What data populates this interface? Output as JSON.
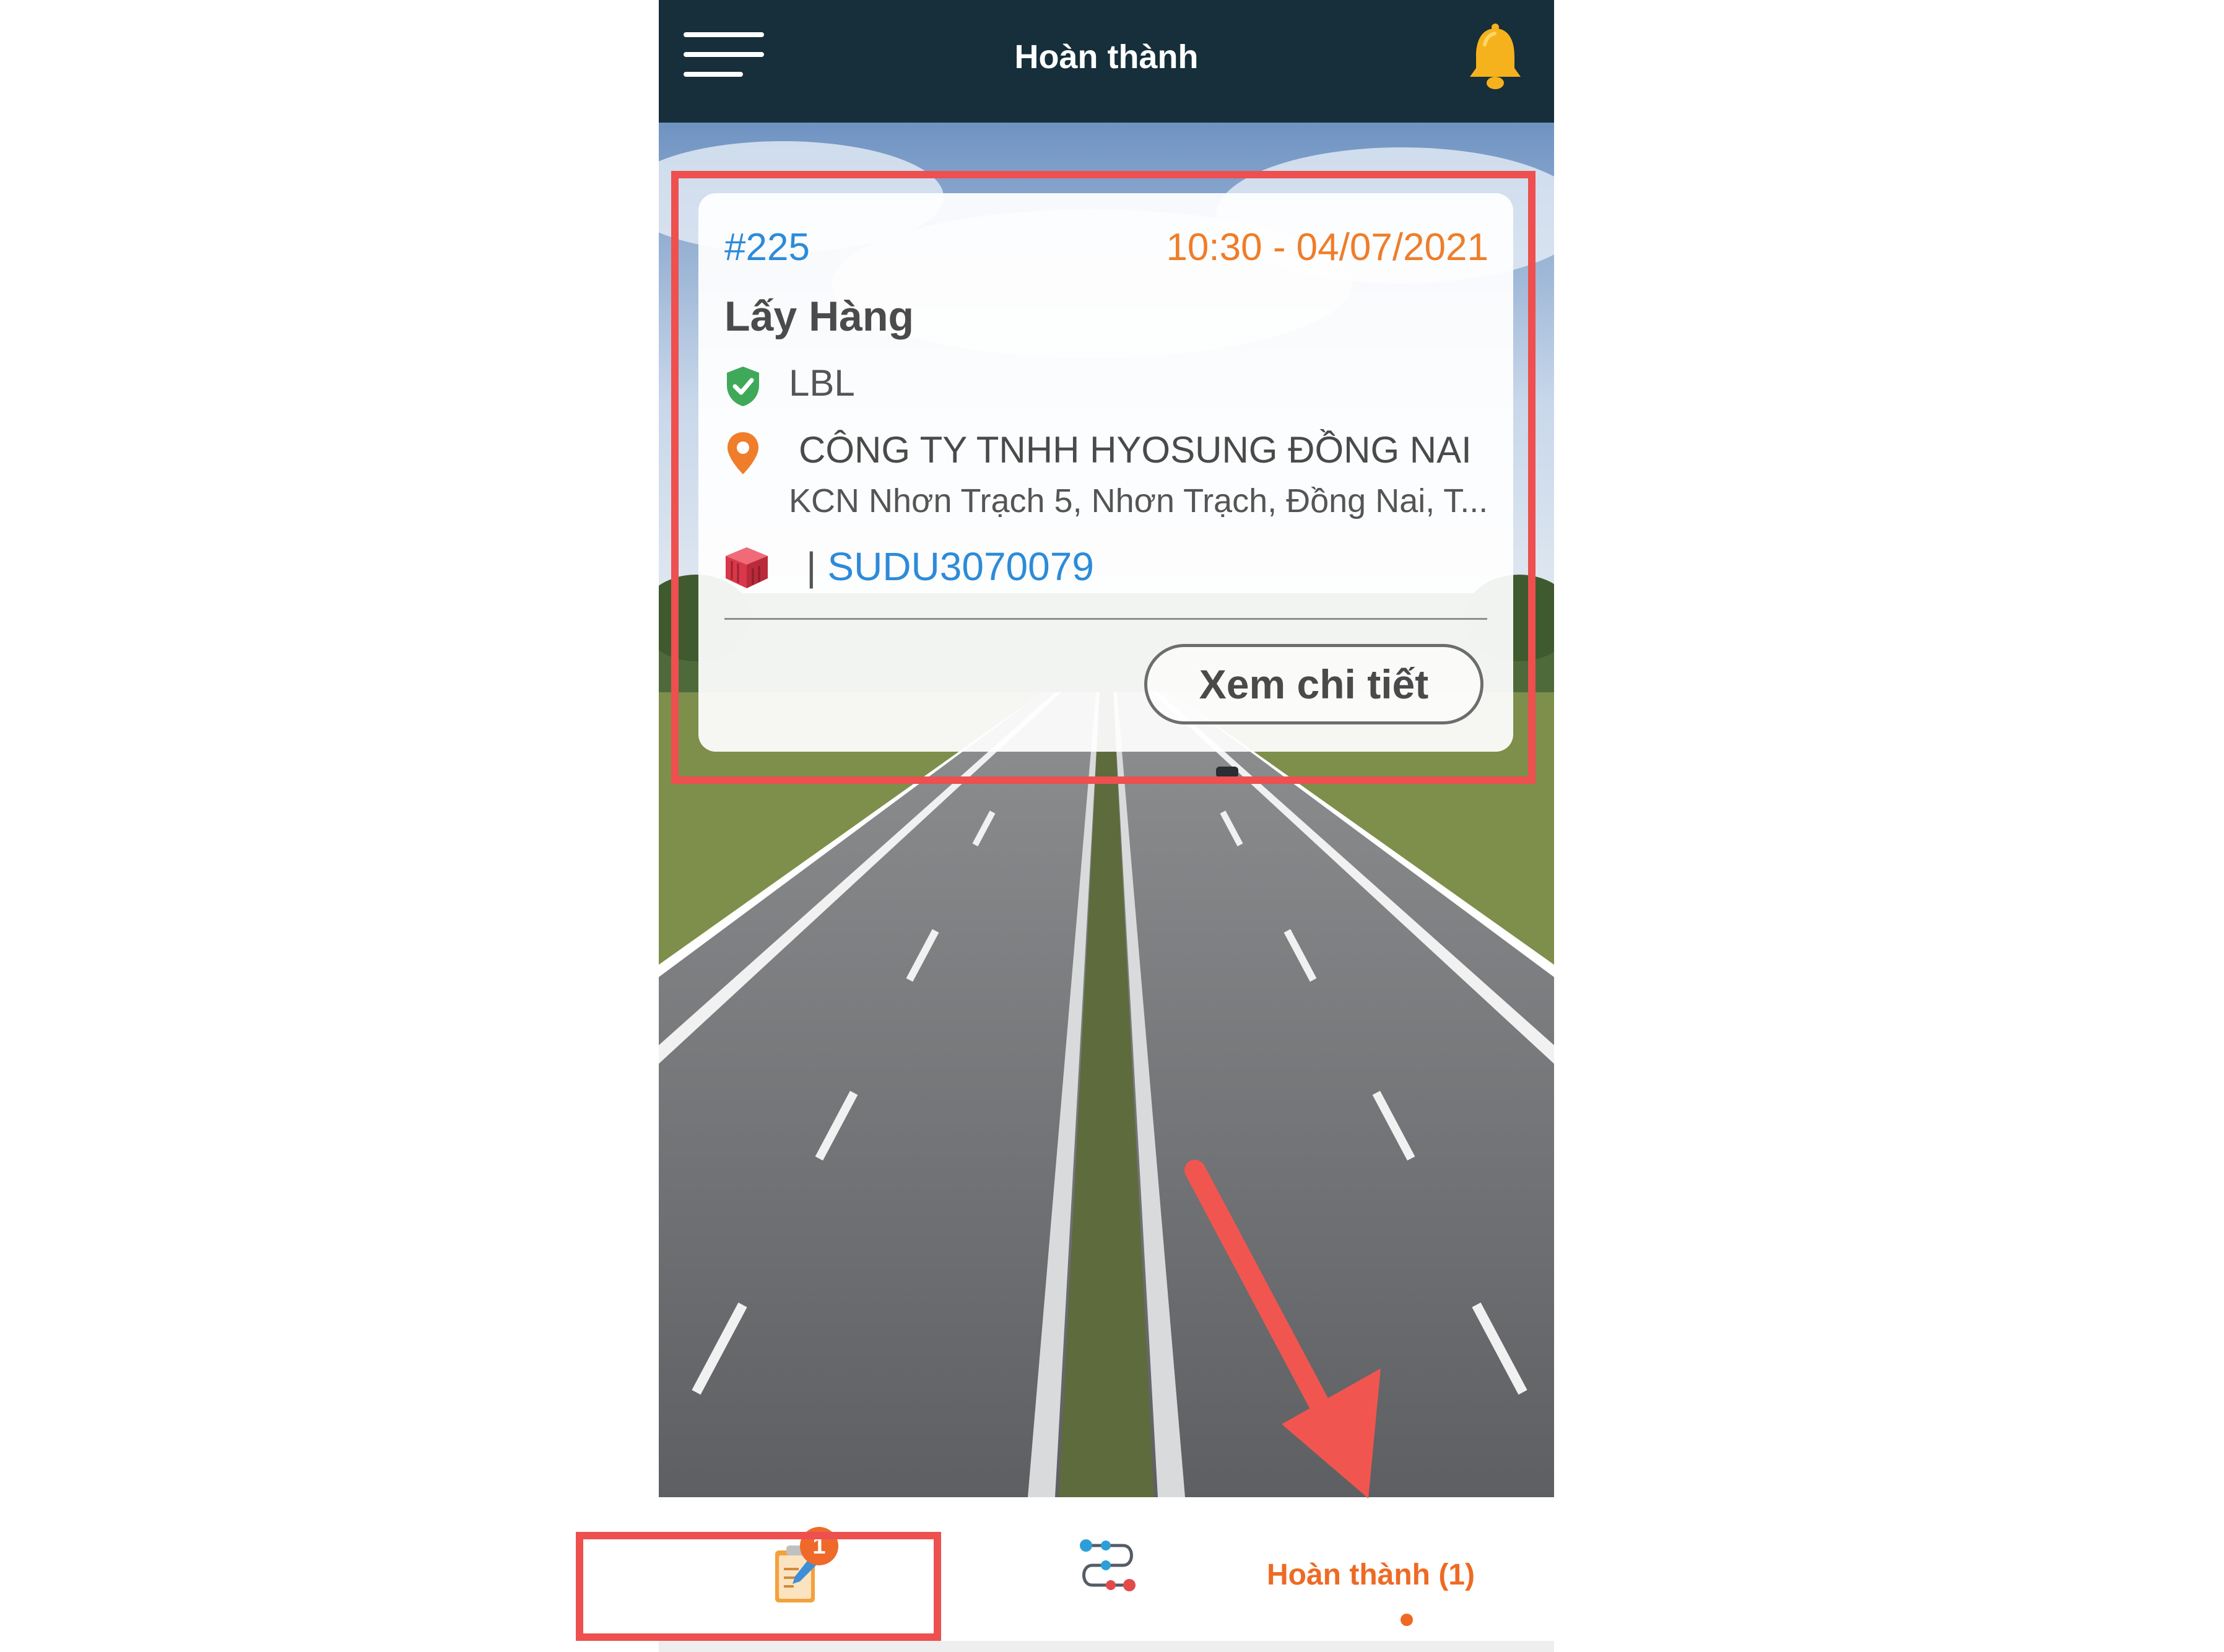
{
  "header": {
    "title": "Hoàn thành",
    "menu_icon": "hamburger-menu-icon",
    "notification_icon": "bell-icon"
  },
  "card": {
    "order_id": "#225",
    "datetime": "10:30 - 04/07/2021",
    "job_type": "Lấy Hàng",
    "customer": "LBL",
    "company": "CÔNG TY TNHH HYOSUNG ĐỒNG NAI",
    "address": "KCN Nhơn Trạch 5, Nhơn Trạch, Đồng Nai, T...",
    "container_separator": "|",
    "container_number": "SUDU3070079",
    "detail_button": "Xem chi tiết"
  },
  "bottom_nav": {
    "tasks_badge": "1",
    "done_tab": "Hoàn thành (1)"
  },
  "colors": {
    "header_bg": "#162f3a",
    "accent_blue": "#2d8bd8",
    "accent_orange": "#ef7d2a",
    "highlight_red": "#ee4f4f"
  }
}
